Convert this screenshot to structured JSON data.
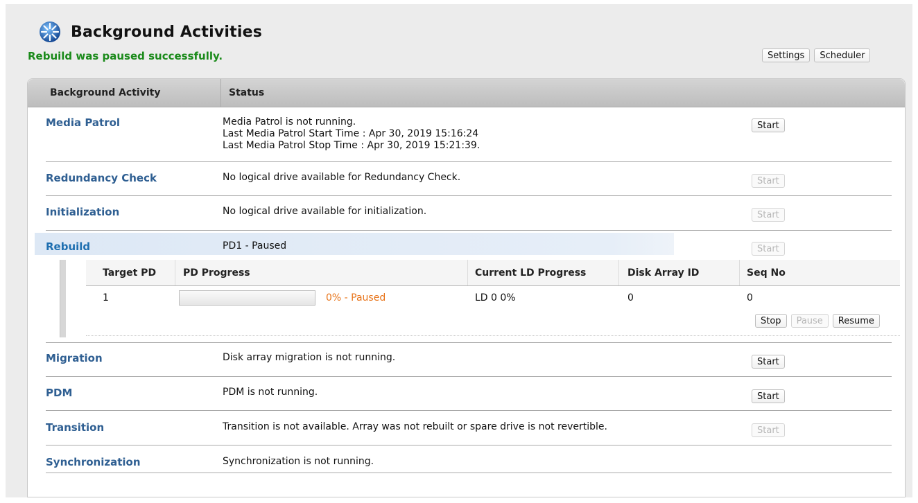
{
  "header": {
    "title": "Background Activities",
    "logo_icon": "globe-icon"
  },
  "message": "Rebuild was paused successfully.",
  "top_buttons": {
    "settings": "Settings",
    "scheduler": "Scheduler"
  },
  "table": {
    "headers": {
      "activity": "Background Activity",
      "status": "Status"
    },
    "rows": [
      {
        "name": "Media Patrol",
        "status": [
          "Media Patrol is not running.",
          "Last Media Patrol Start Time : Apr 30, 2019 15:16:24",
          "Last Media Patrol Stop Time : Apr 30, 2019 15:21:39."
        ],
        "action": "Start",
        "action_enabled": true
      },
      {
        "name": "Redundancy Check",
        "status": [
          "No logical drive available for Redundancy Check."
        ],
        "action": "Start",
        "action_enabled": false
      },
      {
        "name": "Initialization",
        "status": [
          "No logical drive available for initialization."
        ],
        "action": "Start",
        "action_enabled": false
      },
      {
        "name": "Rebuild",
        "status": [
          "PD1 - Paused"
        ],
        "action": "Start",
        "action_enabled": false
      },
      {
        "name": "Migration",
        "status": [
          "Disk array migration is not running."
        ],
        "action": "Start",
        "action_enabled": true
      },
      {
        "name": "PDM",
        "status": [
          "PDM is not running."
        ],
        "action": "Start",
        "action_enabled": true
      },
      {
        "name": "Transition",
        "status": [
          "Transition is not available. Array was not rebuilt or spare drive is not revertible."
        ],
        "action": "Start",
        "action_enabled": false
      },
      {
        "name": "Synchronization",
        "status": [
          "Synchronization is not running."
        ],
        "action": "",
        "action_enabled": false
      }
    ]
  },
  "rebuild_detail": {
    "headers": {
      "target_pd": "Target PD",
      "pd_progress": "PD Progress",
      "ld_progress": "Current LD Progress",
      "disk_array_id": "Disk Array ID",
      "seq_no": "Seq No"
    },
    "row": {
      "target_pd": "1",
      "progress_percent": 0,
      "progress_text": "0% - Paused",
      "ld_progress": "LD 0 0%",
      "disk_array_id": "0",
      "seq_no": "0"
    },
    "buttons": {
      "stop": "Stop",
      "pause": "Pause",
      "resume": "Resume"
    }
  },
  "colors": {
    "success": "#1a8a1a",
    "link": "#2f5f92",
    "paused": "#e8741a"
  }
}
